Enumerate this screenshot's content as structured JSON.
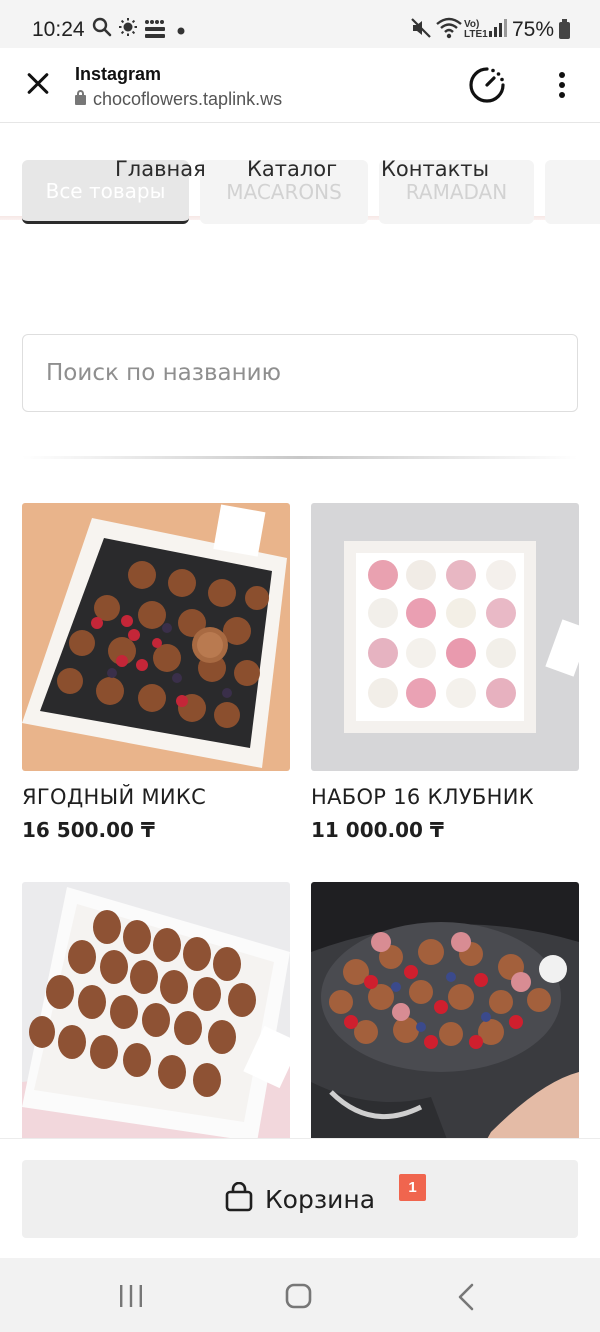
{
  "status_bar": {
    "time": "10:24",
    "battery": "75%",
    "icons": [
      "search-icon",
      "sun-icon",
      "detmir-notification-icon",
      "dot-icon",
      "mute-icon",
      "wifi-icon",
      "volte-icon",
      "signal-icon",
      "battery-icon"
    ]
  },
  "browser": {
    "title": "Instagram",
    "url": "chocoflowers.taplink.ws"
  },
  "nav": {
    "links": [
      "Главная",
      "Каталог",
      "Контакты"
    ]
  },
  "categories": {
    "tabs": [
      "Все товары",
      "MACARONS",
      "RAMADAN"
    ]
  },
  "search": {
    "placeholder": "Поиск по названию"
  },
  "products": [
    {
      "name": "ЯГОДНЫЙ МИКС",
      "price": "16 500.00 ₸"
    },
    {
      "name": "НАБОР 16 КЛУБНИК",
      "price": "11 000.00 ₸"
    },
    {
      "name": "",
      "price": ""
    },
    {
      "name": "",
      "price": ""
    }
  ],
  "cart": {
    "label": "Корзина",
    "count": "1"
  },
  "colors": {
    "badge": "#f0654e",
    "cart_bg": "#efefef",
    "text": "#1f1f1f"
  }
}
